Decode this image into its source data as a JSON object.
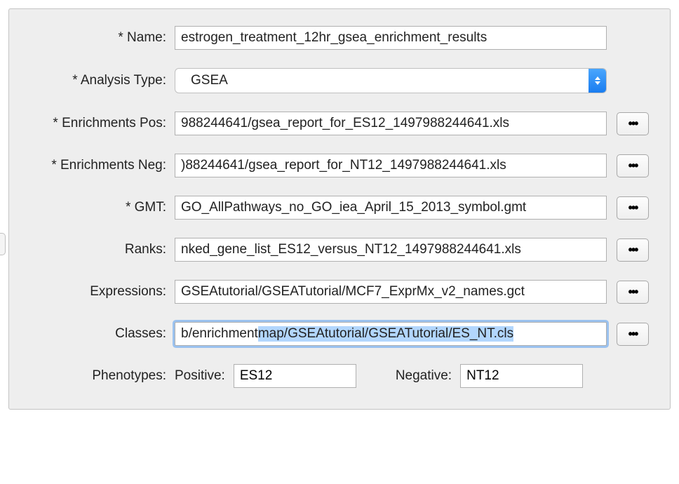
{
  "labels": {
    "name": "* Name:",
    "analysis_type": "* Analysis Type:",
    "enrich_pos": "* Enrichments Pos:",
    "enrich_neg": "* Enrichments Neg:",
    "gmt": "* GMT:",
    "ranks": "Ranks:",
    "expressions": "Expressions:",
    "classes": "Classes:",
    "phenotypes": "Phenotypes:",
    "positive": "Positive:",
    "negative": "Negative:"
  },
  "values": {
    "name": "estrogen_treatment_12hr_gsea_enrichment_results",
    "analysis_type": "GSEA",
    "enrich_pos": "988244641/gsea_report_for_ES12_1497988244641.xls",
    "enrich_neg": ")88244641/gsea_report_for_NT12_1497988244641.xls",
    "gmt": "GO_AllPathways_no_GO_iea_April_15_2013_symbol.gmt",
    "ranks": "nked_gene_list_ES12_versus_NT12_1497988244641.xls",
    "expressions": "GSEAtutorial/GSEATutorial/MCF7_ExprMx_v2_names.gct",
    "classes_pre": "b/enrichment",
    "classes_sel": "map/GSEAtutorial/GSEATutorial/ES_NT.cls",
    "phen_positive": "ES12",
    "phen_negative": "NT12"
  },
  "browse_label": "•••"
}
